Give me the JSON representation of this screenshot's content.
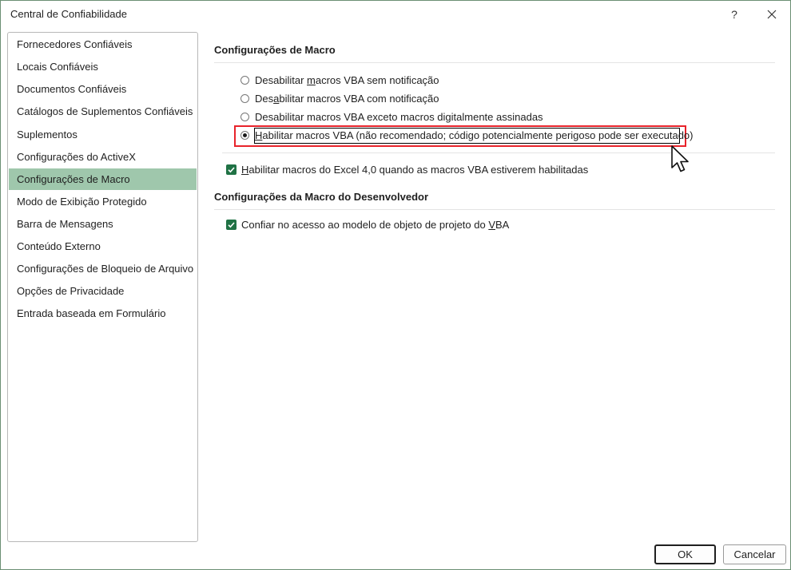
{
  "window": {
    "title": "Central de Confiabilidade",
    "help_label": "?"
  },
  "sidebar": {
    "items": [
      {
        "label": "Fornecedores Confiáveis"
      },
      {
        "label": "Locais Confiáveis"
      },
      {
        "label": "Documentos Confiáveis"
      },
      {
        "label": "Catálogos de Suplementos Confiáveis"
      },
      {
        "label": "Suplementos"
      },
      {
        "label": "Configurações do ActiveX"
      },
      {
        "label": "Configurações de Macro",
        "selected": true
      },
      {
        "label": "Modo de Exibição Protegido"
      },
      {
        "label": "Barra de Mensagens"
      },
      {
        "label": "Conteúdo Externo"
      },
      {
        "label": "Configurações de Bloqueio de Arquivo"
      },
      {
        "label": "Opções de Privacidade"
      },
      {
        "label": "Entrada baseada em Formulário"
      }
    ]
  },
  "macro_settings": {
    "title": "Configurações de Macro",
    "options": [
      {
        "pre": "Desabilitar ",
        "accel": "m",
        "post": "acros VBA sem notificação",
        "checked": false
      },
      {
        "pre": "Des",
        "accel": "a",
        "post": "bilitar macros VBA com notificação",
        "checked": false
      },
      {
        "pre": "Desabilitar macros VBA exceto macros digitalmente assinadas",
        "accel": "",
        "post": "",
        "checked": false
      },
      {
        "pre": "",
        "accel": "H",
        "post": "abilitar macros VBA (não recomendado; código potencialmente perigoso pode ser executado)",
        "checked": true
      }
    ],
    "excel4": {
      "pre": "",
      "accel": "H",
      "post": "abilitar macros do Excel 4,0 quando as macros VBA estiverem habilitadas",
      "checked": true
    }
  },
  "developer_settings": {
    "title": "Configurações da Macro do Desenvolvedor",
    "trust_vba": {
      "pre": "Confiar no acesso ao modelo de objeto de projeto do ",
      "accel": "V",
      "post": "BA",
      "checked": true
    }
  },
  "buttons": {
    "ok": "OK",
    "cancel": "Cancelar"
  },
  "colors": {
    "selected_nav": "#9fc7ac",
    "checkbox": "#207245",
    "highlight": "#e8232b"
  }
}
